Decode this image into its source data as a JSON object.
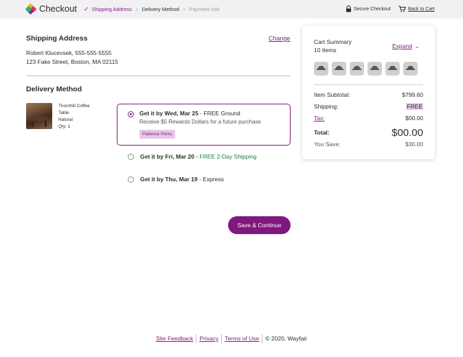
{
  "header": {
    "brand": "Checkout",
    "breadcrumbs": [
      {
        "label": "Shipping Address",
        "state": "done"
      },
      {
        "label": "Delivery Method",
        "state": "active"
      },
      {
        "label": "Payment Info",
        "state": "future"
      }
    ],
    "secure_label": "Secure Checkout",
    "back_label": "Back to Cart"
  },
  "shipping": {
    "heading": "Shipping Address",
    "change_label": "Change",
    "name_line": "Robert Klucevsek, 555-555-5555",
    "address_line": "123 Fake Street, Boston, MA 02115"
  },
  "delivery": {
    "heading": "Delivery Method",
    "product": {
      "name_line1": "Thornhill Coffee",
      "name_line2": "Table",
      "finish": "Natural",
      "qty": "Qty: 1"
    },
    "options": [
      {
        "date": "Get it by Wed, Mar 25",
        "dash": " - ",
        "method": "FREE Ground",
        "selected": true,
        "note": "Receive $5 Rewards Dollars for a future purchase",
        "badge": "Patience Perks"
      },
      {
        "date": "Get it by Fri, Mar 20",
        "dash": " - ",
        "method": "FREE 2-Day Shipping",
        "selected": false
      },
      {
        "date": "Get it by Thu, Mar 19",
        "dash": " - ",
        "method": "Express",
        "selected": false
      }
    ],
    "save_label": "Save & Continue"
  },
  "cart": {
    "title": "Cart Summary",
    "count": "10 Items",
    "expand_label": "Expand",
    "thumbnail_count": 6,
    "rows": {
      "subtotal_label": "Item Subtotal:",
      "subtotal_value": "$799.60",
      "shipping_label": "Shipping:",
      "shipping_value": "FREE",
      "tax_label": "Tax:",
      "tax_value": "$00.00",
      "total_label": "Total:",
      "total_value": "$00.00",
      "save_label": "You Save:",
      "save_value": "$30.00"
    }
  },
  "footer": {
    "links": [
      "Site Feedback",
      "Privacy",
      "Terms of Use"
    ],
    "copyright": "© 2020, Wayfair"
  },
  "colors": {
    "accent": "#7f187f",
    "header_bg": "#f1f0f3",
    "perk_bg": "#e7c7e7",
    "green": "#1e7a3c"
  }
}
